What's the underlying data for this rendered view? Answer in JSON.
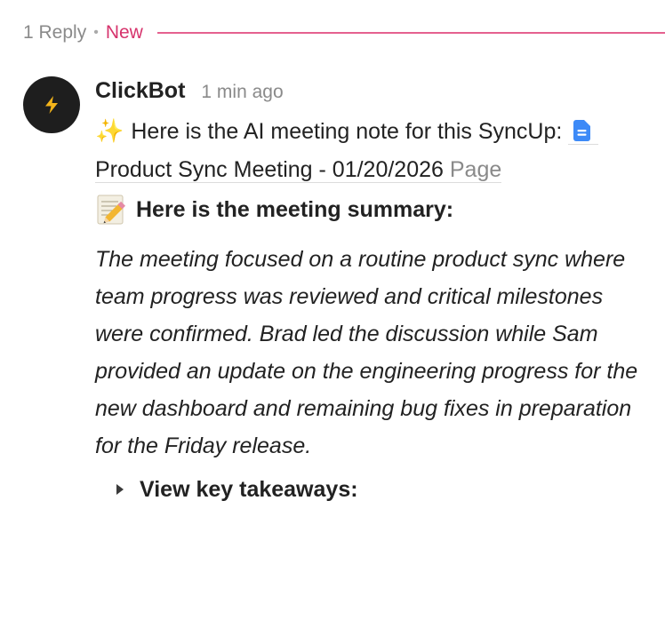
{
  "thread": {
    "reply_count": "1 Reply",
    "separator": "•",
    "new_label": "New",
    "new_color": "#e0457b"
  },
  "message": {
    "avatar_icon": "lightning-bolt-icon",
    "author": "ClickBot",
    "timestamp": "1 min ago",
    "sparkles_emoji": "✨",
    "intro_text": "Here is the AI meeting note for this SyncUp:",
    "linked_doc": {
      "icon": "document-icon",
      "title": "Product Sync Meeting - 01/20/2026",
      "suffix": "Page"
    },
    "summary_heading": "Here is the meeting summary:",
    "summary_icon": "memo-icon",
    "summary": "The meeting focused on a routine product sync where team progress was reviewed and critical milestones were confirmed. Brad led the discussion while Sam provided an update on the engineering progress for the new dashboard and remaining bug fixes in preparation for the Friday release.",
    "toggle_label": "View key takeaways:"
  }
}
